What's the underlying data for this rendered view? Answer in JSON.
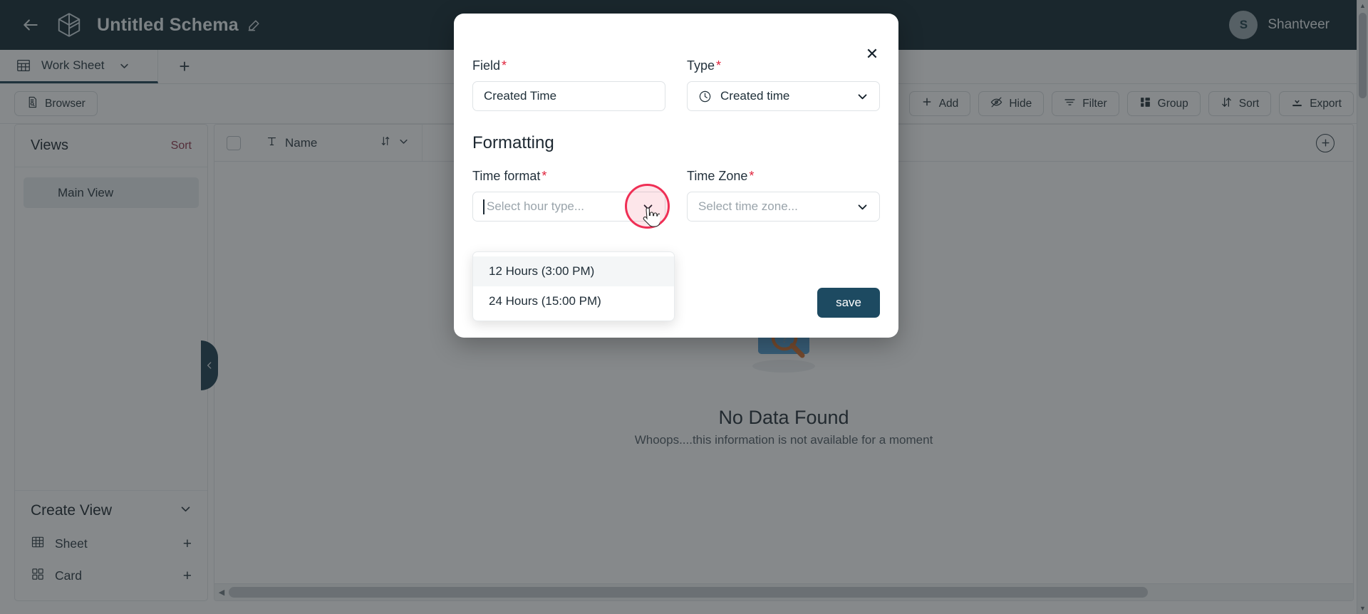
{
  "header": {
    "back_icon": "arrow-left-icon",
    "logo_icon": "cube-logo-icon",
    "title": "Untitled Schema",
    "edit_icon": "pencil-icon",
    "user": {
      "initial": "S",
      "name": "Shantveer"
    },
    "background_color": "#0a2029"
  },
  "tabbar": {
    "sheet_icon": "grid-icon",
    "sheet_label": "Work Sheet",
    "sheet_chevron": "chevron-down-icon",
    "add_tab_label": "+"
  },
  "toolbar": {
    "browser_label": "Browser",
    "browser_icon": "document-search-icon",
    "buttons": [
      {
        "label": "Add",
        "icon": "plus-icon"
      },
      {
        "label": "Hide",
        "icon": "eye-slash-icon"
      },
      {
        "label": "Filter",
        "icon": "filter-icon"
      },
      {
        "label": "Group",
        "icon": "group-icon"
      },
      {
        "label": "Sort",
        "icon": "sort-icon"
      },
      {
        "label": "Export",
        "icon": "download-icon"
      }
    ]
  },
  "sidebar": {
    "views_title": "Views",
    "views_sort_label": "Sort",
    "views": [
      {
        "label": "Main View",
        "icon": "grid-icon"
      }
    ],
    "create_view": {
      "title": "Create View",
      "chevron": "chevron-down-icon",
      "items": [
        {
          "label": "Sheet",
          "icon": "grid-icon",
          "add": "+"
        },
        {
          "label": "Card",
          "icon": "card-grid-icon",
          "add": "+"
        }
      ]
    }
  },
  "table": {
    "columns": [
      {
        "label": "Name",
        "type_icon": "text-type-icon"
      }
    ],
    "sort_icon": "sort-arrows-icon",
    "menu_icon": "chevron-down-icon",
    "add_column_icon": "circle-plus-icon",
    "empty": {
      "title": "No Data Found",
      "subtitle": "Whoops....this information is not available for a moment",
      "illustration": "folder-search-icon"
    }
  },
  "collapse_handle": {
    "icon": "chevron-left-icon"
  },
  "modal": {
    "close_icon": "close-icon",
    "field": {
      "label": "Field",
      "required": "*",
      "value": "Created Time"
    },
    "type": {
      "label": "Type",
      "required": "*",
      "value": "Created time",
      "icon": "clock-icon",
      "chevron": "chevron-down-icon"
    },
    "formatting": {
      "section_title": "Formatting",
      "time_format": {
        "label": "Time format",
        "required": "*",
        "placeholder": "Select hour type...",
        "value": "",
        "chevron": "chevron-down-icon",
        "options": [
          "12 Hours (3:00 PM)",
          "24 Hours (15:00 PM)"
        ],
        "hovered_option_index": 0
      },
      "time_zone": {
        "label": "Time Zone",
        "required": "*",
        "placeholder": "Select time zone...",
        "value": "",
        "chevron": "chevron-down-icon"
      }
    },
    "save_label": "save",
    "save_color": "#1d4a61",
    "highlight_color": "#ef2f55"
  }
}
